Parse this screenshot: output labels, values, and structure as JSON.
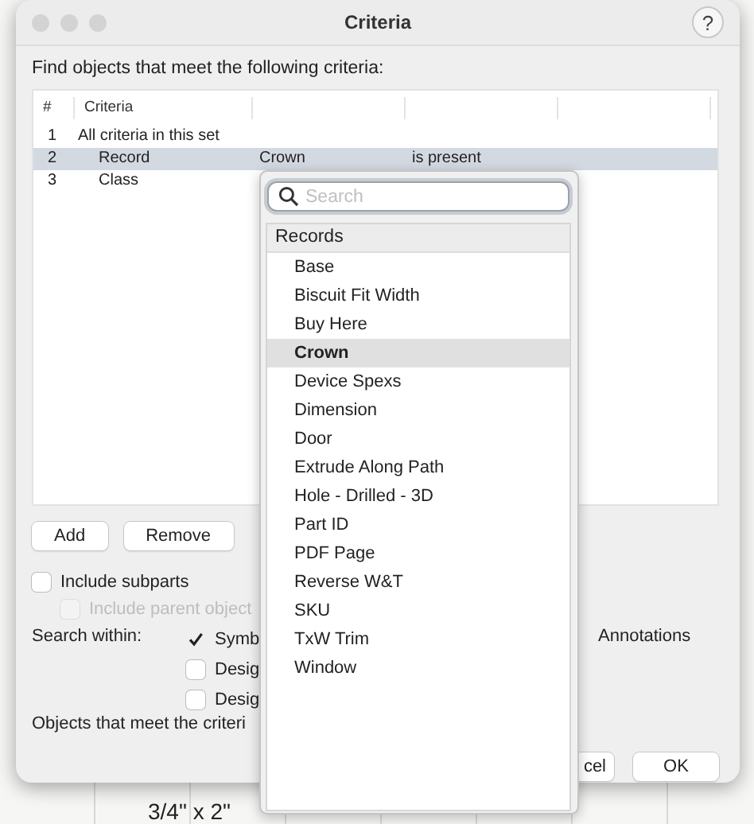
{
  "window": {
    "title": "Criteria",
    "help": "?"
  },
  "prompt": "Find objects that meet the following criteria:",
  "table": {
    "columns": [
      "#",
      "Criteria"
    ],
    "rows": [
      {
        "number": "1",
        "criteria": "All criteria in this set",
        "selected": false,
        "children": [
          {
            "number": "2",
            "criteria": "Record",
            "value": "Crown",
            "condition": "is present",
            "selected": true
          },
          {
            "number": "3",
            "criteria": "Class",
            "selected": false
          }
        ]
      }
    ]
  },
  "buttons": [
    "Add",
    "Remove"
  ],
  "include_subparts": {
    "label": "Include subparts",
    "checked": false,
    "disabled": false
  },
  "include_parent": {
    "label": "Include parent object",
    "checked": false,
    "disabled": true
  },
  "search_within": {
    "label": "Search within:",
    "options": [
      {
        "label": "Symb",
        "checked": true
      },
      {
        "label": "Desig",
        "checked": false
      },
      {
        "label": "Desig",
        "checked": false
      }
    ],
    "extra": "Annotations"
  },
  "result_text": "Objects that meet the criteri",
  "dialog_buttons": [
    "cel",
    "OK"
  ],
  "popup": {
    "search": {
      "placeholder": "Search"
    },
    "group": "Records",
    "items": [
      {
        "label": "Base",
        "selected": false
      },
      {
        "label": "Biscuit Fit Width",
        "selected": false
      },
      {
        "label": "Buy Here",
        "selected": false
      },
      {
        "label": "Crown",
        "selected": true
      },
      {
        "label": "Device Spexs",
        "selected": false
      },
      {
        "label": "Dimension",
        "selected": false
      },
      {
        "label": "Door",
        "selected": false
      },
      {
        "label": "Extrude Along Path",
        "selected": false
      },
      {
        "label": "Hole - Drilled - 3D",
        "selected": false
      },
      {
        "label": "Part ID",
        "selected": false
      },
      {
        "label": "PDF Page",
        "selected": false
      },
      {
        "label": "Reverse W&T",
        "selected": false
      },
      {
        "label": "SKU",
        "selected": false
      },
      {
        "label": "TxW Trim",
        "selected": false
      },
      {
        "label": "Window",
        "selected": false
      }
    ]
  },
  "background": {
    "cells": [
      "3/4\" x 2\""
    ]
  }
}
